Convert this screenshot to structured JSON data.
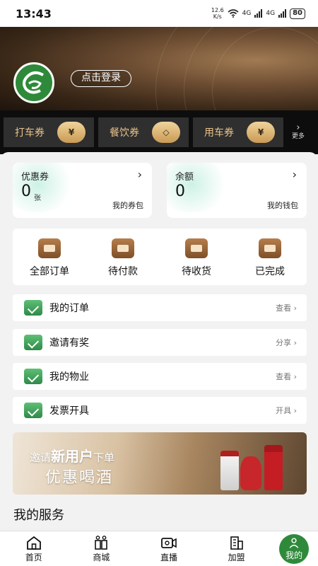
{
  "status_bar": {
    "time": "13:43",
    "speed_value": "12.6",
    "speed_unit": "K/s",
    "network": "4G",
    "network2": "4G",
    "battery": "80"
  },
  "header": {
    "login_label": "点击登录",
    "logo_icon": "brand-logo-icon"
  },
  "coupon_strip": {
    "items": [
      {
        "label": "打车券",
        "icon": "coin-icon",
        "glyph": "¥"
      },
      {
        "label": "餐饮券",
        "icon": "tag-icon",
        "glyph": "◇"
      },
      {
        "label": "用车券",
        "icon": "ticket-icon",
        "glyph": "¥"
      }
    ],
    "more_label": "更多"
  },
  "cards": {
    "coupon": {
      "title": "优惠券",
      "value": "0",
      "unit": "张",
      "footer": "我的券包"
    },
    "balance": {
      "title": "余额",
      "value": "0",
      "footer": "我的钱包"
    }
  },
  "orders": [
    {
      "label": "全部订单",
      "icon": "order-list-icon"
    },
    {
      "label": "待付款",
      "icon": "money-bag-icon"
    },
    {
      "label": "待收货",
      "icon": "clock-box-icon"
    },
    {
      "label": "已完成",
      "icon": "check-box-icon"
    }
  ],
  "menu_rows": [
    {
      "label": "我的订单",
      "action": "查看",
      "icon": "order-icon"
    },
    {
      "label": "邀请有奖",
      "action": "分享",
      "icon": "invite-icon"
    },
    {
      "label": "我的物业",
      "action": "查看",
      "icon": "property-icon"
    },
    {
      "label": "发票开具",
      "action": "开具",
      "icon": "invoice-icon"
    }
  ],
  "banner": {
    "line1_a": "邀请",
    "line1_b": "新用户",
    "line1_c": "下单",
    "line2": "优惠喝酒"
  },
  "services_title": "我的服务",
  "tabbar": [
    {
      "label": "首页",
      "icon": "home-icon"
    },
    {
      "label": "商城",
      "icon": "shop-icon"
    },
    {
      "label": "直播",
      "icon": "live-icon"
    },
    {
      "label": "加盟",
      "icon": "building-icon"
    },
    {
      "label": "我的",
      "icon": "user-icon"
    }
  ],
  "colors": {
    "brand_green": "#2e8a3a",
    "gold": "#e9c38b",
    "dark_strip": "#0d0d0d"
  }
}
